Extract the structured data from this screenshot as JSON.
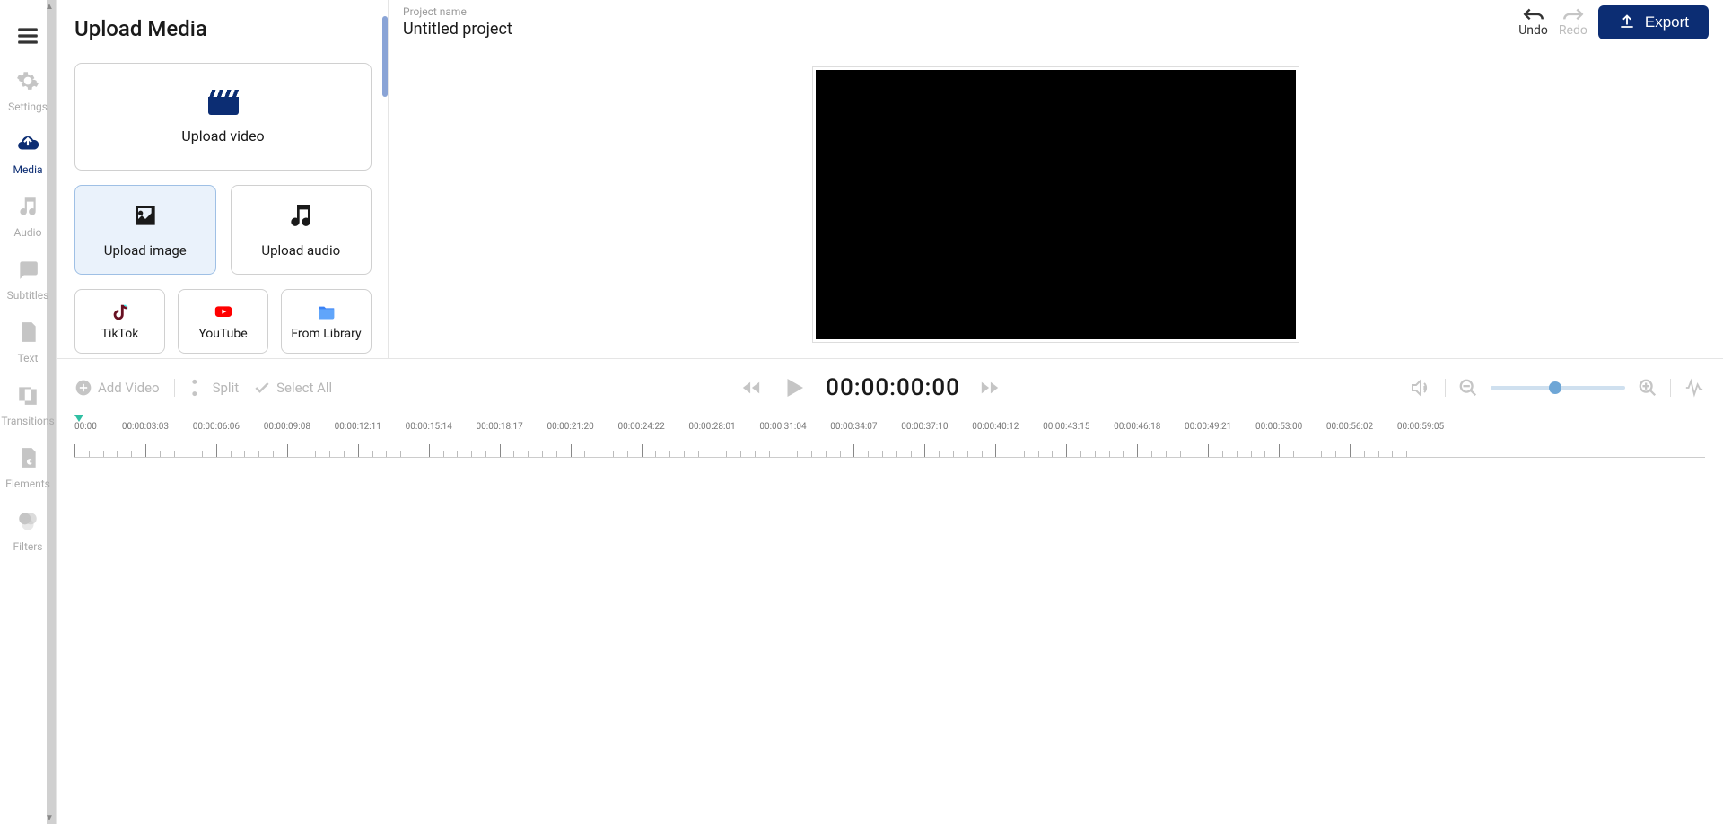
{
  "sidebar": {
    "items": [
      {
        "id": "settings",
        "label": "Settings"
      },
      {
        "id": "media",
        "label": "Media"
      },
      {
        "id": "audio",
        "label": "Audio"
      },
      {
        "id": "subtitles",
        "label": "Subtitles"
      },
      {
        "id": "text",
        "label": "Text"
      },
      {
        "id": "transitions",
        "label": "Transitions"
      },
      {
        "id": "elements",
        "label": "Elements"
      },
      {
        "id": "filters",
        "label": "Filters"
      }
    ],
    "active": "media"
  },
  "panel": {
    "title": "Upload Media",
    "upload_video_label": "Upload video",
    "upload_image_label": "Upload image",
    "upload_audio_label": "Upload audio",
    "sources": [
      {
        "id": "tiktok",
        "label": "TikTok"
      },
      {
        "id": "youtube",
        "label": "YouTube"
      },
      {
        "id": "library",
        "label": "From Library"
      }
    ]
  },
  "header": {
    "project_label": "Project name",
    "project_name": "Untitled project",
    "undo_label": "Undo",
    "redo_label": "Redo",
    "export_label": "Export"
  },
  "controls": {
    "add_video_label": "Add Video",
    "split_label": "Split",
    "select_all_label": "Select All",
    "timecode": "00:00:00:00"
  },
  "ruler": {
    "labels": [
      "00:00",
      "00:00:03:03",
      "00:00:06:06",
      "00:00:09:08",
      "00:00:12:11",
      "00:00:15:14",
      "00:00:18:17",
      "00:00:21:20",
      "00:00:24:22",
      "00:00:28:01",
      "00:00:31:04",
      "00:00:34:07",
      "00:00:37:10",
      "00:00:40:12",
      "00:00:43:15",
      "00:00:46:18",
      "00:00:49:21",
      "00:00:53:00",
      "00:00:56:02",
      "00:00:59:05"
    ]
  }
}
